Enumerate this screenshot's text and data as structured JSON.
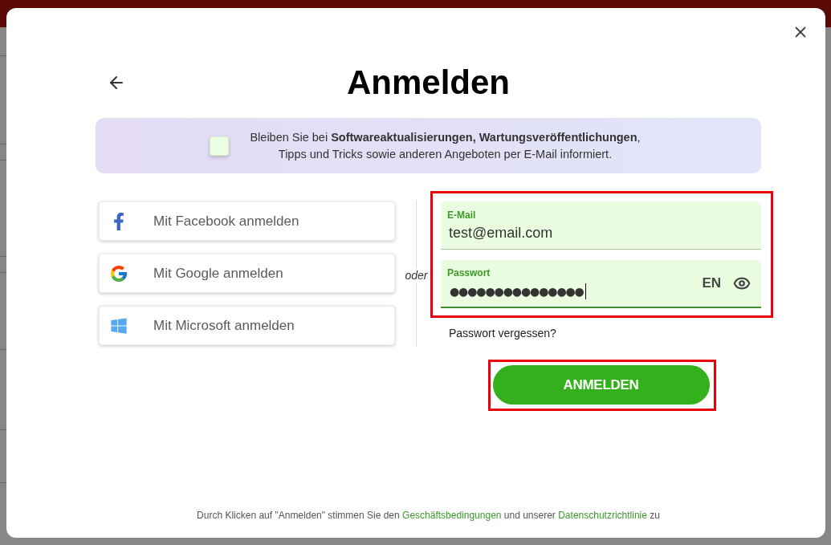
{
  "dialog": {
    "title": "Anmelden",
    "newsletter": {
      "text": "Bleiben Sie bei **Softwareaktualisierungen, Wartungsveröffentlichungen**,\nTipps und Tricks sowie anderen Angeboten per E-Mail informiert.",
      "checked": false
    },
    "social_logins": [
      {
        "kind": "facebook",
        "label": "Mit Facebook anmelden"
      },
      {
        "kind": "google",
        "label": "Mit Google anmelden"
      },
      {
        "kind": "microsoft",
        "label": "Mit Microsoft anmelden"
      }
    ],
    "separator": "oder",
    "form": {
      "highlighted": true,
      "fields": [
        {
          "kind": "email",
          "label": "E-Mail",
          "value": "test@email.com",
          "focused": false
        },
        {
          "kind": "password",
          "label": "Passwort",
          "value": "●●●●●●●●●●●●●●●",
          "focused": true,
          "input_language": "EN"
        }
      ]
    },
    "forgot_password": "Passwort vergessen?",
    "submit": {
      "label": "ANMELDEN",
      "highlighted": true
    },
    "terms": [
      {
        "kind": "text",
        "text": "Durch Klicken auf \"Anmelden\" stimmen Sie den "
      },
      {
        "kind": "link",
        "text": "Geschäftsbedingungen"
      },
      {
        "kind": "text",
        "text": " und unserer "
      },
      {
        "kind": "link",
        "text": "Datenschutzrichtlinie"
      },
      {
        "kind": "text",
        "text": " zu"
      }
    ]
  }
}
